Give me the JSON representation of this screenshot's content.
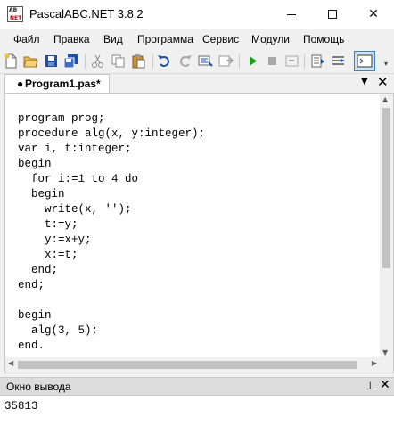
{
  "window": {
    "title": "PascalABC.NET 3.8.2",
    "icon_line1": "AB",
    "icon_line2": "NET"
  },
  "menu": [
    "Файл",
    "Правка",
    "Вид",
    "Программа",
    "Сервис",
    "Модули",
    "Помощь"
  ],
  "toolbar": {
    "icons": [
      "new-file-icon",
      "open-icon",
      "save-icon",
      "save-all-icon",
      "cut-icon",
      "copy-icon",
      "paste-icon",
      "undo-icon",
      "redo-icon",
      "format-icon",
      "export-icon",
      "run-icon",
      "stop-icon",
      "step-icon",
      "watch-icon",
      "debug-icon",
      "console-icon",
      "overflow-icon"
    ],
    "colors": {
      "run": "#1a9e1a",
      "stop": "#808080",
      "save": "#1e4fa8"
    }
  },
  "tab": {
    "label": "Program1.pas*",
    "modified_marker": "●"
  },
  "editor": {
    "lines": [
      "program prog;",
      "procedure alg(x, y:integer);",
      "var i, t:integer;",
      "begin",
      "  for i:=1 to 4 do",
      "  begin",
      "    write(x, '');",
      "    t:=y;",
      "    y:=x+y;",
      "    x:=t;",
      "  end;",
      "end;",
      "",
      "begin",
      "  alg(3, 5);",
      "end."
    ]
  },
  "output": {
    "title": "Окно вывода",
    "text": "35813"
  }
}
